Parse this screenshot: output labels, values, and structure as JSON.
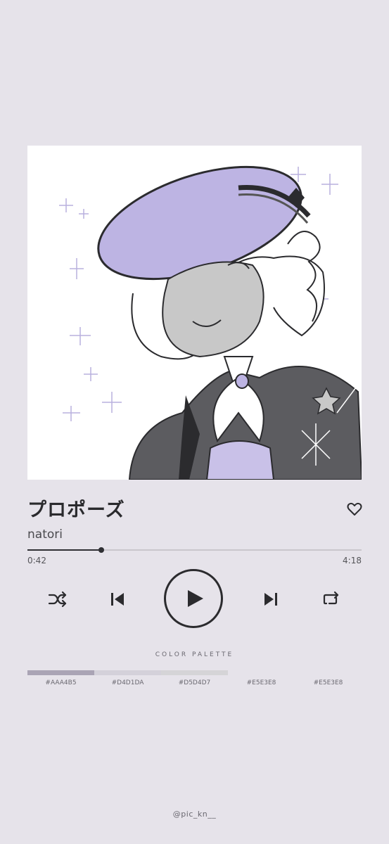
{
  "track": {
    "title": "プロポーズ",
    "artist": "natori",
    "elapsed": "0:42",
    "total": "4:18",
    "progress_fraction": 0.222
  },
  "artwork": {
    "icon": "album-art-illustration",
    "accent": "#B9B0DE"
  },
  "controls": {
    "like": "heart-outline-icon",
    "shuffle": "shuffle-icon",
    "previous": "skip-previous-icon",
    "play": "play-icon",
    "next": "skip-next-icon",
    "repeat": "repeat-icon"
  },
  "palette": {
    "label": "COLOR PALETTE",
    "colors": [
      {
        "code": "#AAA4B5",
        "hex": "#AAA4B5"
      },
      {
        "code": "#D4D1DA",
        "hex": "#D4D1DA"
      },
      {
        "code": "#D5D4D7",
        "hex": "#D5D4D7"
      },
      {
        "code": "#E5E3E8",
        "hex": "#E5E3E8"
      },
      {
        "code": "#E5E3E8",
        "hex": "#E5E3E8"
      }
    ]
  },
  "credit": "@pic_kn__",
  "colors": {
    "background": "#E6E3EA",
    "text": "#2B2B2E"
  }
}
